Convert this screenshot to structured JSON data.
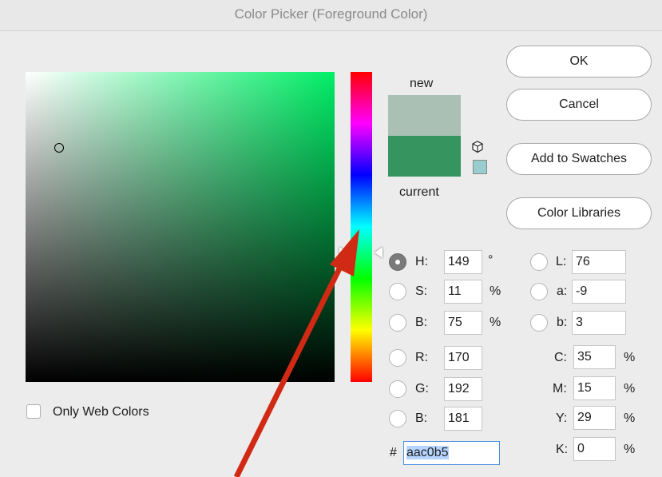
{
  "window": {
    "title": "Color Picker (Foreground Color)"
  },
  "buttons": {
    "ok": "OK",
    "cancel": "Cancel",
    "add_to_swatches": "Add to Swatches",
    "color_libraries": "Color Libraries"
  },
  "preview": {
    "new_label": "new",
    "current_label": "current",
    "new_color": "#aac0b5",
    "current_color": "#36955f"
  },
  "hsb": {
    "h": {
      "label": "H:",
      "value": "149",
      "unit": "°",
      "selected": true
    },
    "s": {
      "label": "S:",
      "value": "11",
      "unit": "%"
    },
    "b": {
      "label": "B:",
      "value": "75",
      "unit": "%"
    }
  },
  "rgb": {
    "r": {
      "label": "R:",
      "value": "170"
    },
    "g": {
      "label": "G:",
      "value": "192"
    },
    "b": {
      "label": "B:",
      "value": "181"
    }
  },
  "lab": {
    "l": {
      "label": "L:",
      "value": "76"
    },
    "a": {
      "label": "a:",
      "value": "-9"
    },
    "b": {
      "label": "b:",
      "value": "3"
    }
  },
  "cmyk": {
    "c": {
      "label": "C:",
      "value": "35",
      "unit": "%"
    },
    "m": {
      "label": "M:",
      "value": "15",
      "unit": "%"
    },
    "y": {
      "label": "Y:",
      "value": "29",
      "unit": "%"
    },
    "k": {
      "label": "K:",
      "value": "0",
      "unit": "%"
    }
  },
  "hex": {
    "symbol": "#",
    "value": "aac0b5"
  },
  "options": {
    "only_web_colors": "Only Web Colors"
  },
  "icons": {
    "gamut": "cube-icon",
    "arrow": "red-arrow-annotation"
  },
  "colors": {
    "arrow": "#d12a14",
    "field_hue": "#00ee66"
  }
}
